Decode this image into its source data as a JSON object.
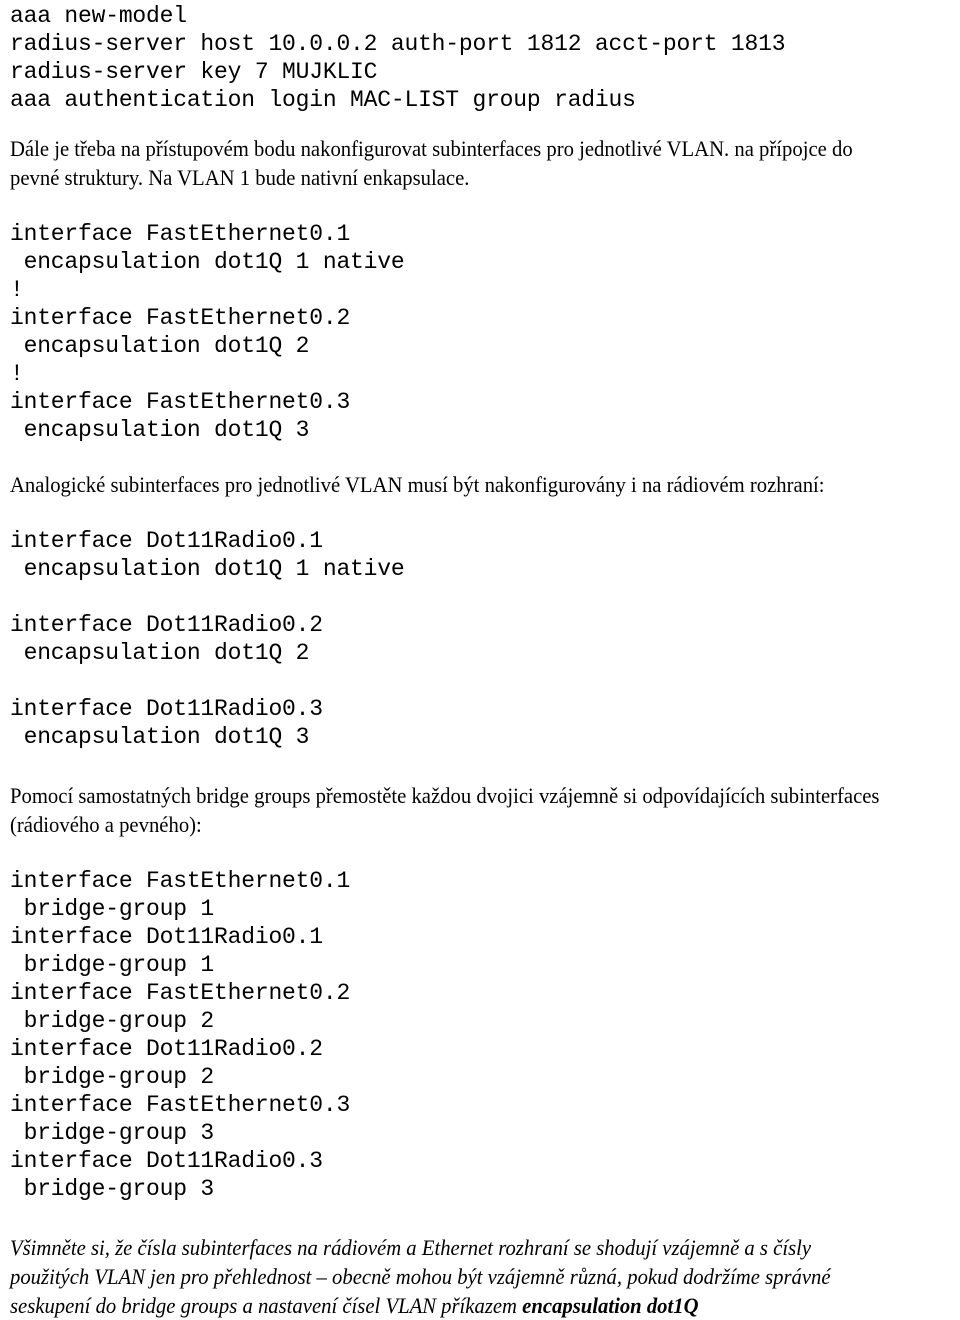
{
  "document": {
    "language": "cs",
    "blocks": [
      {
        "id": "config-aaa-radius",
        "type": "code",
        "lines": [
          "aaa new-model",
          "radius-server host 10.0.0.2 auth-port 1812 acct-port 1813",
          "radius-server key 7 MUJKLIC",
          "aaa authentication login MAC-LIST group radius"
        ]
      },
      {
        "id": "para-subinterfaces-intro",
        "type": "paragraph",
        "text": "Dále je třeba na přístupovém bodu nakonfigurovat subinterfaces pro jednotlivé VLAN. na přípojce do pevné struktury. Na VLAN 1 bude nativní enkapsulace."
      },
      {
        "id": "config-fastethernet-encapsulation",
        "type": "code",
        "lines": [
          "interface FastEthernet0.1",
          " encapsulation dot1Q 1 native",
          "!",
          "interface FastEthernet0.2",
          " encapsulation dot1Q 2",
          "!",
          "interface FastEthernet0.3",
          " encapsulation dot1Q 3"
        ]
      },
      {
        "id": "para-radio-subinterfaces",
        "type": "paragraph",
        "text": "Analogické subinterfaces pro jednotlivé VLAN musí být nakonfigurovány i na rádiovém rozhraní:"
      },
      {
        "id": "config-dot11radio-encapsulation",
        "type": "code",
        "lines": [
          "interface Dot11Radio0.1",
          " encapsulation dot1Q 1 native",
          "",
          "interface Dot11Radio0.2",
          " encapsulation dot1Q 2",
          "",
          "interface Dot11Radio0.3",
          " encapsulation dot1Q 3"
        ]
      },
      {
        "id": "para-bridge-groups",
        "type": "paragraph",
        "text": "Pomocí samostatných bridge groups  přemostěte každou dvojici vzájemně si odpovídajících subinterfaces (rádiového a pevného):"
      },
      {
        "id": "config-bridge-groups",
        "type": "code",
        "lines": [
          "interface FastEthernet0.1",
          " bridge-group 1",
          "interface Dot11Radio0.1",
          " bridge-group 1",
          "interface FastEthernet0.2",
          " bridge-group 2",
          "interface Dot11Radio0.2",
          " bridge-group 2",
          "interface FastEthernet0.3",
          " bridge-group 3",
          "interface Dot11Radio0.3",
          " bridge-group 3"
        ]
      },
      {
        "id": "para-note-italic",
        "type": "paragraph-italic",
        "text_before": "Všimněte si, že čísla subinterfaces na rádiovém a Ethernet rozhraní se shodují vzájemně a s čísly použitých VLAN jen pro přehlednost – obecně mohou být vzájemně různá, pokud dodržíme správné seskupení do bridge groups a nastavení čísel VLAN příkazem ",
        "text_emphasis": "encapsulation dot1Q"
      }
    ]
  }
}
